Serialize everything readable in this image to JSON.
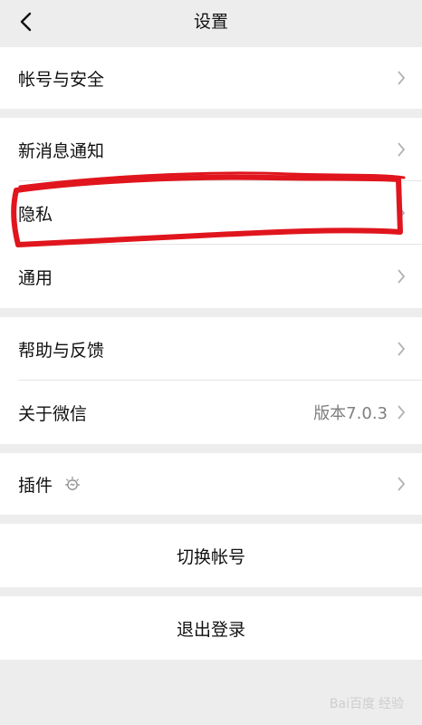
{
  "nav": {
    "title": "设置",
    "back_icon": "chevron-left-icon"
  },
  "sections": [
    {
      "items": [
        {
          "label": "帐号与安全"
        }
      ]
    },
    {
      "items": [
        {
          "label": "新消息通知"
        },
        {
          "label": "隐私"
        },
        {
          "label": "通用"
        }
      ]
    },
    {
      "items": [
        {
          "label": "帮助与反馈"
        },
        {
          "label": "关于微信",
          "value": "版本7.0.3"
        }
      ]
    },
    {
      "items": [
        {
          "label": "插件",
          "icon": "lightbulb-icon"
        }
      ]
    }
  ],
  "actions": {
    "switch_account": "切换帐号",
    "logout": "退出登录"
  },
  "annotation": {
    "color": "#e0151d",
    "shape": "hand-drawn-outline",
    "target": "隐私"
  },
  "watermark": {
    "text": "经验",
    "logo": "Bai百度"
  },
  "colors": {
    "background": "#ededed",
    "row": "#ffffff",
    "text": "#111111",
    "secondary_text": "#7f7f7f",
    "chevron": "#b2b2b2"
  }
}
